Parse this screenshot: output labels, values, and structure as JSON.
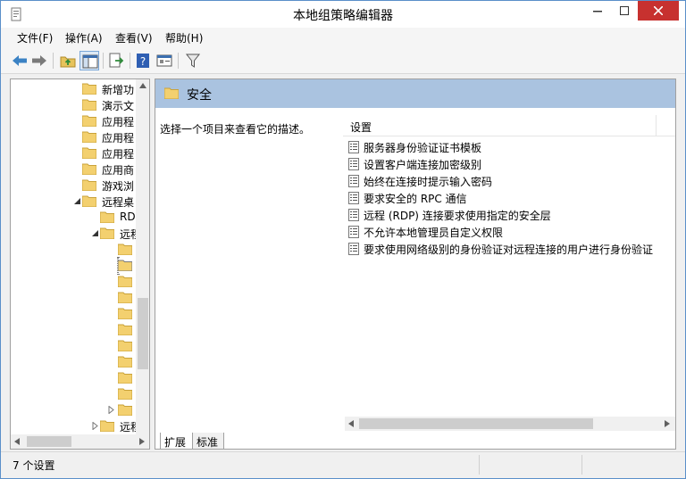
{
  "window": {
    "title": "本地组策略编辑器"
  },
  "menu": [
    {
      "label": "文件(F)"
    },
    {
      "label": "操作(A)"
    },
    {
      "label": "查看(V)"
    },
    {
      "label": "帮助(H)"
    }
  ],
  "toolbar": {
    "icons": [
      "back-arrow-icon",
      "forward-arrow-icon",
      "up-folder-icon",
      "show-hide-tree-icon",
      "export-list-icon",
      "help-icon",
      "properties-icon",
      "filter-icon"
    ]
  },
  "tree": {
    "items": [
      {
        "label": "新增功"
      },
      {
        "label": "演示文"
      },
      {
        "label": "应用程"
      },
      {
        "label": "应用程"
      },
      {
        "label": "应用程"
      },
      {
        "label": "应用商"
      },
      {
        "label": "游戏浏"
      },
      {
        "label": "远程桌"
      },
      {
        "label": "RD"
      },
      {
        "label": "远程"
      },
      {
        "label": "远程"
      }
    ]
  },
  "pane": {
    "title": "安全",
    "description": "选择一个项目来查看它的描述。",
    "column_header": "设置",
    "settings": [
      {
        "label": "服务器身份验证证书模板"
      },
      {
        "label": "设置客户端连接加密级别"
      },
      {
        "label": "始终在连接时提示输入密码"
      },
      {
        "label": "要求安全的 RPC 通信"
      },
      {
        "label": "远程 (RDP) 连接要求使用指定的安全层"
      },
      {
        "label": "不允许本地管理员自定义权限"
      },
      {
        "label": "要求使用网络级别的身份验证对远程连接的用户进行身份验证"
      }
    ]
  },
  "tabs": [
    {
      "label": "扩展"
    },
    {
      "label": "标准"
    }
  ],
  "status": {
    "text": "7 个设置"
  },
  "colors": {
    "header_bg": "#aac3e0",
    "close_red": "#c7312f",
    "folder_yellow": "#f3d06f"
  }
}
